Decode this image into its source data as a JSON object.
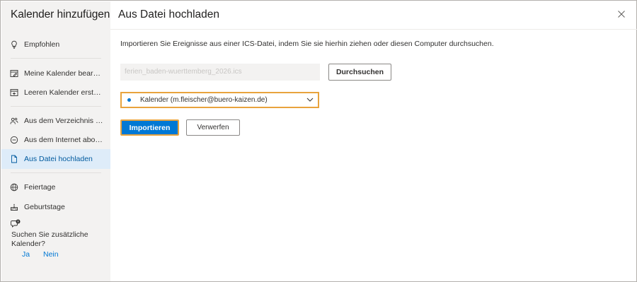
{
  "sidebar": {
    "title": "Kalender hinzufügen",
    "items": [
      {
        "label": "Empfohlen",
        "icon": "lightbulb-icon"
      },
      {
        "label": "Meine Kalender bearbei…",
        "icon": "calendar-edit-icon"
      },
      {
        "label": "Leeren Kalender erstellen",
        "icon": "calendar-add-icon"
      },
      {
        "label": "Aus dem Verzeichnis hi…",
        "icon": "people-icon"
      },
      {
        "label": "Aus dem Internet abon…",
        "icon": "link-icon"
      },
      {
        "label": "Aus Datei hochladen",
        "icon": "document-icon",
        "active": true
      },
      {
        "label": "Feiertage",
        "icon": "globe-icon"
      },
      {
        "label": "Geburtstage",
        "icon": "cake-icon"
      }
    ],
    "feedback": {
      "question": "Suchen Sie zusätzliche Kalender?",
      "yes": "Ja",
      "no": "Nein"
    }
  },
  "main": {
    "title": "Aus Datei hochladen",
    "intro": "Importieren Sie Ereignisse aus einer ICS-Datei, indem Sie sie hierhin ziehen oder diesen Computer durchsuchen.",
    "file_name": "ferien_baden-wuerttemberg_2026.ics",
    "browse_label": "Durchsuchen",
    "calendar_select": "Kalender (m.fleischer@buero-kaizen.de)",
    "import_label": "Importieren",
    "discard_label": "Verwerfen"
  },
  "colors": {
    "accent": "#0078d4",
    "focus_outline": "#e8a33d",
    "sidebar_bg": "#f3f2f1",
    "active_bg": "#deecf9"
  }
}
